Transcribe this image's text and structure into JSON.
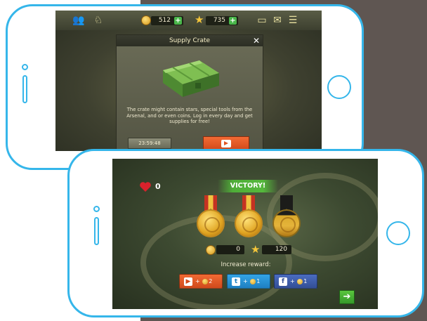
{
  "screen1": {
    "topbar": {
      "icons": [
        "friends-icon",
        "achievements-icon",
        "coin-icon",
        "star-icon",
        "video-offer-icon",
        "mail-icon",
        "menu-icon"
      ],
      "coins": "512",
      "stars": "735",
      "plus": "+"
    },
    "crate_dialog": {
      "title": "Supply Crate",
      "close": "✕",
      "description": "The crate might contain stars, special tools from the Arsenal, and or even coins. Log in every day and get supplies for free!",
      "timer": "23:59:48"
    }
  },
  "screen2": {
    "hearts": "0",
    "banner": "VICTORY!",
    "medals_earned": 2,
    "medals_total": 3,
    "coins": "0",
    "stars": "120",
    "increase_reward": "Increase reward:",
    "rewards": [
      {
        "icon": "video-icon",
        "text": "+ 2"
      },
      {
        "icon": "twitter-icon",
        "text": "+ 1"
      },
      {
        "icon": "facebook-icon",
        "text": "+ 1"
      }
    ],
    "next": "➔"
  },
  "colors": {
    "phone_outline": "#35b6ea",
    "background_block": "#5f5652",
    "victory_green": "#4fae38",
    "orange_button": "#f26a33"
  }
}
